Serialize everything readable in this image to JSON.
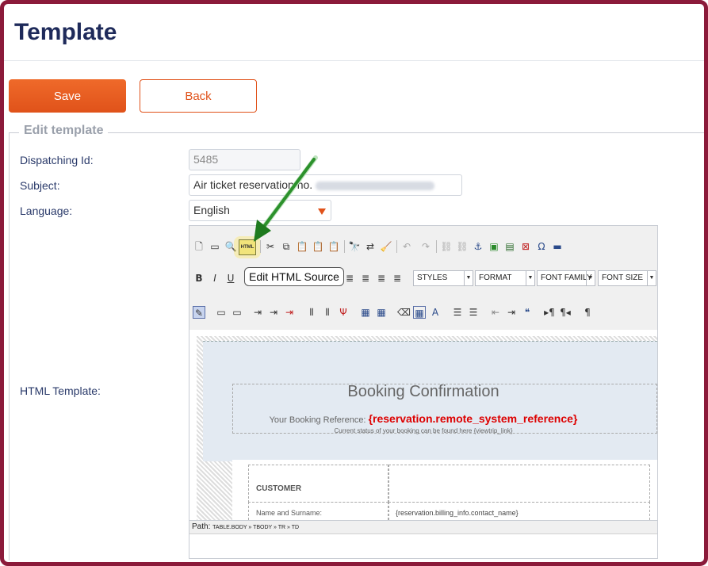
{
  "page": {
    "title": "Template"
  },
  "buttons": {
    "save": "Save",
    "back": "Back"
  },
  "section": {
    "legend": "Edit template"
  },
  "form": {
    "dispatching_label": "Dispatching Id:",
    "dispatching_value": "5485",
    "subject_label": "Subject:",
    "subject_value": "Air ticket reservation no.",
    "language_label": "Language:",
    "language_value": "English",
    "html_template_label": "HTML Template:"
  },
  "editor": {
    "tooltip": "Edit HTML Source",
    "html_button": "HTML",
    "dropdowns": {
      "styles": "STYLES",
      "format": "FORMAT",
      "font_family": "FONT FAMILY",
      "font_size": "FONT SIZE"
    },
    "content": {
      "title": "Booking Confirmation",
      "ref_prefix": "Your Booking Reference:",
      "ref_variable": "{reservation.remote_system_reference}",
      "status_text": "Current status of your booking can be found here {viewtrip_link}",
      "customer_heading": "CUSTOMER",
      "name_label": "Name and Surname:",
      "name_value": "{reservation.billing_info.contact_name}"
    },
    "path_label": "Path:",
    "path_value": "TABLE.BODY » TBODY » TR » TD"
  },
  "colors": {
    "accent": "#e0521a",
    "frame": "#8b1a3a",
    "title": "#1e2a5a",
    "variable": "#dd0000"
  }
}
